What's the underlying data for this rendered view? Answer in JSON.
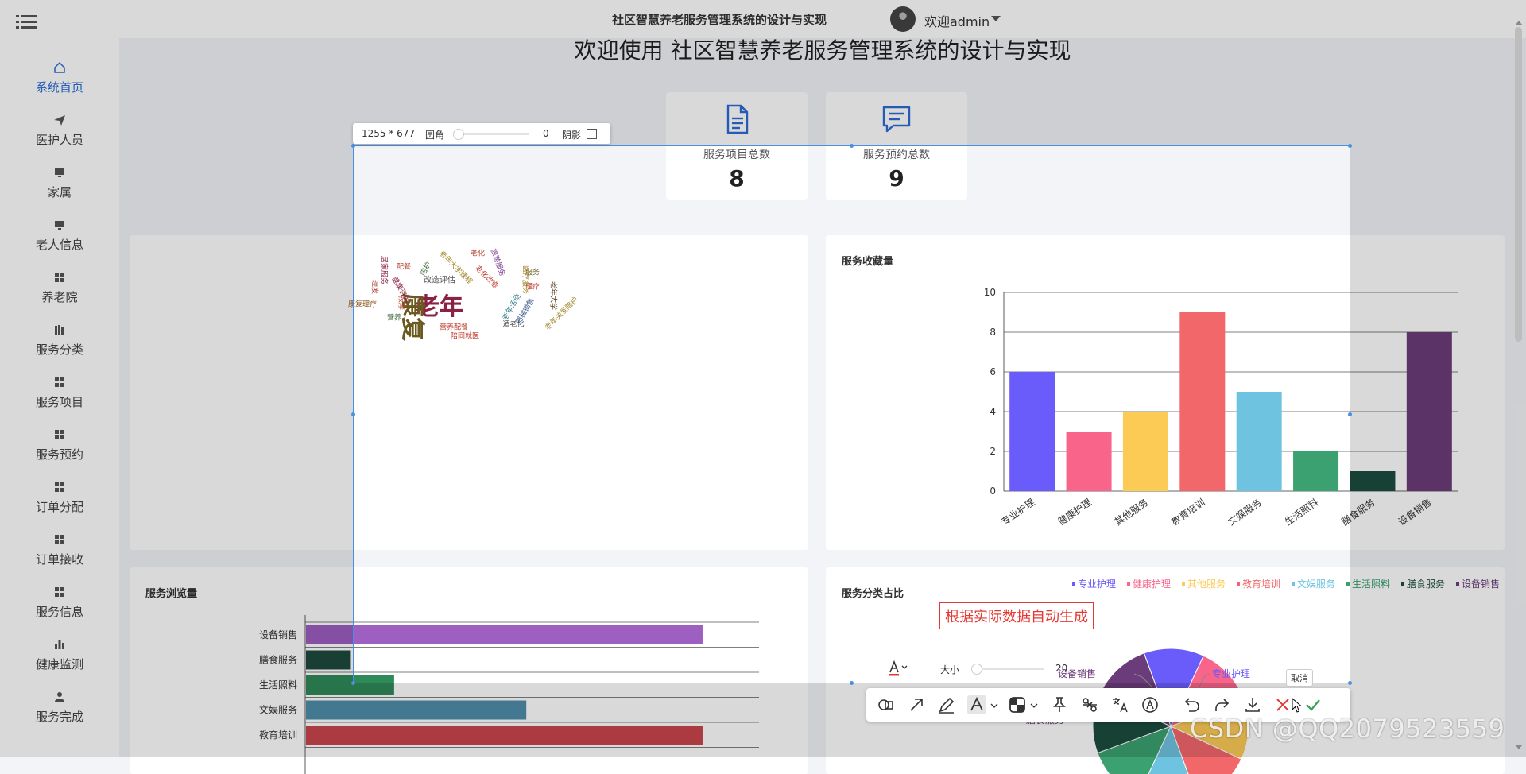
{
  "header": {
    "system_title": "社区智慧养老服务管理系统的设计与实现",
    "welcome": "欢迎admin"
  },
  "page_title": "欢迎使用 社区智慧养老服务管理系统的设计与实现",
  "sidebar": {
    "items": [
      {
        "label": "系统首页",
        "icon": "home-icon",
        "active": true
      },
      {
        "label": "医护人员",
        "icon": "send-icon"
      },
      {
        "label": "家属",
        "icon": "monitor-icon"
      },
      {
        "label": "老人信息",
        "icon": "monitor-icon"
      },
      {
        "label": "养老院",
        "icon": "grid-icon"
      },
      {
        "label": "服务分类",
        "icon": "books-icon"
      },
      {
        "label": "服务项目",
        "icon": "grid-icon"
      },
      {
        "label": "服务预约",
        "icon": "grid-icon"
      },
      {
        "label": "订单分配",
        "icon": "grid-icon"
      },
      {
        "label": "订单接收",
        "icon": "grid-icon"
      },
      {
        "label": "服务信息",
        "icon": "grid-icon"
      },
      {
        "label": "健康监测",
        "icon": "bar-chart-icon"
      },
      {
        "label": "服务完成",
        "icon": "user-icon"
      }
    ]
  },
  "stats": [
    {
      "label": "服务项目总数",
      "value": "8",
      "icon": "document-icon"
    },
    {
      "label": "服务预约总数",
      "value": "9",
      "icon": "message-icon"
    }
  ],
  "panels": {
    "favorites_title": "服务收藏量",
    "browse_title": "服务浏览量",
    "category_title": "服务分类占比"
  },
  "wordcloud": {
    "words": [
      {
        "text": "老年",
        "color": "#8a2246"
      },
      {
        "text": "康复",
        "color": "#6b5a1e"
      },
      {
        "text": "改造评估",
        "color": "#555555"
      },
      {
        "text": "老年大学课程",
        "color": "#a0862c"
      },
      {
        "text": "老化",
        "color": "#b2402f"
      },
      {
        "text": "旅游服务",
        "color": "#7a3e8e"
      },
      {
        "text": "老化改造",
        "color": "#c0392b"
      },
      {
        "text": "营养配餐",
        "color": "#c0392b"
      },
      {
        "text": "适老化",
        "color": "#4a4a4a"
      },
      {
        "text": "陪同就医",
        "color": "#c0392b"
      },
      {
        "text": "康复理疗",
        "color": "#8a5a1e"
      },
      {
        "text": "营养",
        "color": "#3d6b3d"
      },
      {
        "text": "按摩",
        "color": "#b2402f"
      },
      {
        "text": "服务",
        "color": "#6b5a1e"
      },
      {
        "text": "理疗",
        "color": "#c0392b"
      },
      {
        "text": "老年大学",
        "color": "#5a3d1e"
      },
      {
        "text": "老年关爱陪护",
        "color": "#a0862c"
      },
      {
        "text": "器械销售",
        "color": "#3a5a8e"
      },
      {
        "text": "老年活动",
        "color": "#2d7a8e"
      },
      {
        "text": "配餐",
        "color": "#b2402f"
      },
      {
        "text": "陪护",
        "color": "#3d6b3d"
      },
      {
        "text": "健康咨询",
        "color": "#8a2246"
      },
      {
        "text": "医疗服务",
        "color": "#a0862c"
      },
      {
        "text": "居家服务",
        "color": "#8a2246"
      },
      {
        "text": "理发",
        "color": "#b2402f"
      }
    ]
  },
  "chart_data": [
    {
      "type": "bar",
      "title": "服务收藏量",
      "categories": [
        "专业护理",
        "健康护理",
        "其他服务",
        "教育培训",
        "文娱服务",
        "生活照料",
        "膳食服务",
        "设备销售"
      ],
      "values": [
        6,
        3,
        4,
        9,
        5,
        2,
        1,
        8
      ],
      "colors": [
        "#6a5cfa",
        "#f8648a",
        "#fbcb56",
        "#f1676a",
        "#6ec3e0",
        "#3ca170",
        "#1b4d3e",
        "#6b3c7a"
      ],
      "ylim": [
        0,
        10
      ],
      "yticks": [
        "0",
        "2",
        "4",
        "6",
        "8",
        "10"
      ],
      "grid": true
    },
    {
      "type": "bar",
      "orientation": "horizontal",
      "title": "服务浏览量",
      "categories": [
        "设备销售",
        "膳食服务",
        "生活照料",
        "文娱服务",
        "教育培训"
      ],
      "values": [
        9,
        1,
        2,
        5,
        9
      ],
      "colors": [
        "#9d5fc0",
        "#1e4a3e",
        "#2f8a5a",
        "#4f8faa",
        "#c9464d"
      ],
      "xlim": [
        0,
        10
      ]
    },
    {
      "type": "pie",
      "title": "服务分类占比",
      "legend": [
        "专业护理",
        "健康护理",
        "其他服务",
        "教育培训",
        "文娱服务",
        "生活照料",
        "膳食服务",
        "设备销售"
      ],
      "colors": [
        "#6a5cfa",
        "#f8648a",
        "#fbcb56",
        "#f1676a",
        "#6ec3e0",
        "#3ca170",
        "#1b4d3e",
        "#6b3c7a"
      ],
      "legend_position": "top-right",
      "visible_labels": [
        "设备销售",
        "专业护理",
        "膳食服务"
      ]
    }
  ],
  "capture": {
    "size_label": "1255 * 677",
    "radius_label": "圆角",
    "radius_value": "0",
    "shadow_label": "阴影",
    "annotation_text": "根据实际数据自动生成",
    "size_opt_label": "大小",
    "size_opt_value": "20",
    "cancel_tooltip": "取消",
    "tools": [
      "shape-icon",
      "arrow-icon",
      "pen-icon",
      "text-icon",
      "mosaic-icon",
      "pin-icon",
      "ocr-icon",
      "translate-icon",
      "recognize-icon",
      "undo-icon",
      "redo-icon",
      "download-icon",
      "cancel-icon",
      "confirm-icon"
    ]
  },
  "watermark": "CSDN @QQ2079523559"
}
